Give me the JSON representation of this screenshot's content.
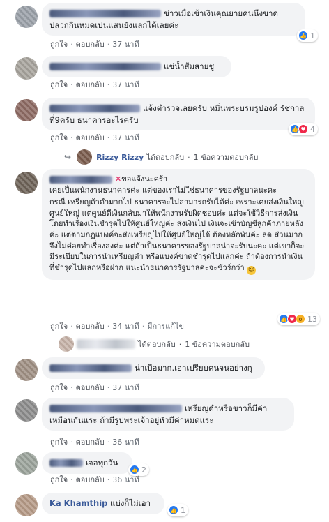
{
  "common": {
    "like": "ถูกใจ",
    "reply": "ตอบกลับ",
    "sep": "·",
    "edited": "มีการแก้ไข"
  },
  "comments": [
    {
      "text": "ข่าวเมื่อเช้าเงินคุณยายคนนึงขาด ปลวกกินหมดเปนแสนยังแลกได้เลยค่ะ",
      "time": "37 นาที",
      "reactions": {
        "icons": [
          "like"
        ],
        "count": "1"
      }
    },
    {
      "text": "แช่น้ำส้มสายชู",
      "time": "37 นาที"
    },
    {
      "text": "แจ้งตำรวจเลยครับ หมิ่นพระบรมรูปองค์ รัชกาลที่9ครับ ธนาคารอะไรครับ",
      "time": "37 นาที",
      "reactions": {
        "icons": [
          "like",
          "love"
        ],
        "count": "4"
      },
      "reply_summary": {
        "name": "Rizzy Rizzy",
        "action": "ได้ตอบกลับ",
        "count_text": "1 ข้อความตอบกลับ"
      }
    },
    {
      "badge_text": "ขอแจ้งนะคร้า",
      "text": "เคยเป็นพนักงานธนาคารค่ะ แต่ของเราไม่ใช่ธนาคารของรัฐบาลนะคะ",
      "text2": "กรณี เหรียญถ้าดำมากไป ธนาคารจะไม่สามารถรับได้ค่ะ เพราะเคยส่งเงินใหญ่ศูนย์ใหญ่ แต่ศูนย์ตีเงินกลับมาให้พนักงานรับผิดชอบค่ะ แต่จะใช้วิธีการส่งเงินโดยทำเรื่องเงินชำรุดไปให้ศูนย์ใหญ่ค่ะ ส่งเงินไป เงินจะเข้าบัญชีลูกค้าภายหลังค่ะ แต่ตามกฎแบงค์จะส่งเหรียญไปให้ศูนย์ใหญ่ได้ ต้องหลักพันค่ะ ลด ส่วนมากจึงไม่ค่อยทำเรื่องส่งค่ะ แต่ถ้าเป็นธนาคารของรัฐบาลน่าจะรับนะคะ แต่เขาก็จะมีระเบียบในการนำเหรียญดำ หรือแบงค์ขาดชำรุดไปแลกค่ะ ถ้าต้องการนำเงินที่ชำรุดไปแลกหรือฝาก แนะนำธนาคารรัฐบาลค่ะจะชัวร์กว่า",
      "time": "34 นาที",
      "reactions": {
        "icons": [
          "like",
          "love",
          "wow"
        ],
        "count": "13"
      },
      "reply_summary": {
        "action": "ได้ตอบกลับ",
        "count_text": "1 ข้อความตอบกลับ"
      }
    },
    {
      "text": "น่าเบื่อมาก.เอาเปรียบคนจนอย่างกุ",
      "time": "37 นาที"
    },
    {
      "text": "เหรียญดำหรือขาวก็มีค่าเหมือนกันแระ ถ้ามีรูปพระเจ้าอยู่หัวมีค่าหมดแระ",
      "time": "36 นาที"
    },
    {
      "text": "เจอทุกวัน",
      "time": "36 นาที",
      "reactions": {
        "icons": [
          "like"
        ],
        "count": "2"
      }
    },
    {
      "name": "Ka Khamthip",
      "text": "แบ่งก็ไม่เอา",
      "reactions": {
        "icons": [
          "like"
        ],
        "count": "1"
      }
    }
  ]
}
